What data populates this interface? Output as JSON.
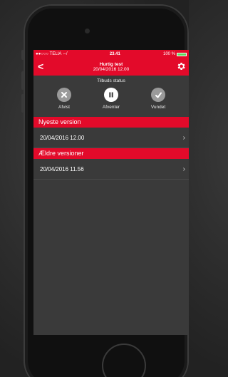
{
  "statusbar": {
    "carrier": "●●○○○ TELIA ⇎",
    "time": "23.41",
    "battery": "100 %"
  },
  "navbar": {
    "back": "<",
    "title": "Hurtig test",
    "subtitle": "20/04/2016 12.00"
  },
  "status_panel": {
    "heading": "Tilbuds status",
    "options": [
      {
        "label": "Afvist",
        "icon": "x-icon"
      },
      {
        "label": "Afventer",
        "icon": "pause-icon"
      },
      {
        "label": "Vundet",
        "icon": "check-icon"
      }
    ]
  },
  "newest": {
    "header": "Nyeste version",
    "rows": [
      {
        "value": "20/04/2016 12.00"
      }
    ]
  },
  "older": {
    "header": "Ældre versioner",
    "rows": [
      {
        "value": "20/04/2016 11.56"
      }
    ]
  },
  "colors": {
    "accent": "#e30a2a",
    "background": "#3a3a3a"
  }
}
